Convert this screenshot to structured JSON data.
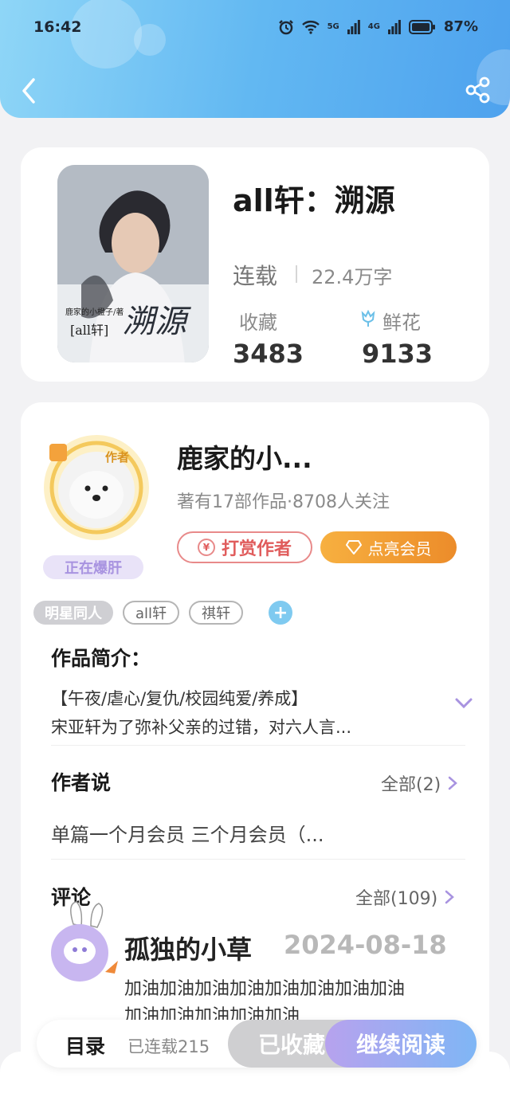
{
  "status_bar": {
    "time": "16:42",
    "signal1": "5G",
    "signal2": "4G",
    "battery": "87%"
  },
  "book": {
    "cover_text_author": "鹿家的小橙子/著",
    "cover_text_tag": "[all轩]",
    "cover_text_title": "溯源",
    "title": "all轩：溯源",
    "status": "连载",
    "word_count": "22.4万字",
    "favorites_label": "收藏",
    "flowers_label": "鲜花",
    "favorites_count": "3483",
    "flowers_count": "9133"
  },
  "author": {
    "name": "鹿家的小...",
    "meta": "著有17部作品·8708人关注",
    "badge": "作者",
    "status_sticker": "正在爆肝",
    "tip_label": "打赏作者",
    "vip_label": "点亮会员"
  },
  "tags": [
    "明星同人",
    "all轩",
    "祺轩"
  ],
  "intro": {
    "title": "作品简介：",
    "line1": "【午夜/虐心/复仇/校园纯爱/养成】",
    "line2": "宋亚轩为了弥补父亲的过错，对六人言..."
  },
  "author_say": {
    "title": "作者说",
    "all_label": "全部(2)",
    "text": "单篇一个月会员  三个月会员（..."
  },
  "comments": {
    "title": "评论",
    "all_label": "全部(109)",
    "items": [
      {
        "user": "孤独的小草",
        "date": "2024-08-18",
        "line1": "加油加油加油加油加油加油加油加油",
        "line2": "加油加油加油加油加油"
      }
    ]
  },
  "bottom_bar": {
    "toc_label": "目录",
    "serial_count": "已连载215",
    "collected_label": "已收藏",
    "read_label": "继续阅读"
  },
  "colors": {
    "header_start": "#8fd6f7",
    "header_end": "#4ea2ee",
    "tip_red": "#e05c5c",
    "vip_orange": "#ec8c2a",
    "read_purple": "#b7a2ee"
  }
}
